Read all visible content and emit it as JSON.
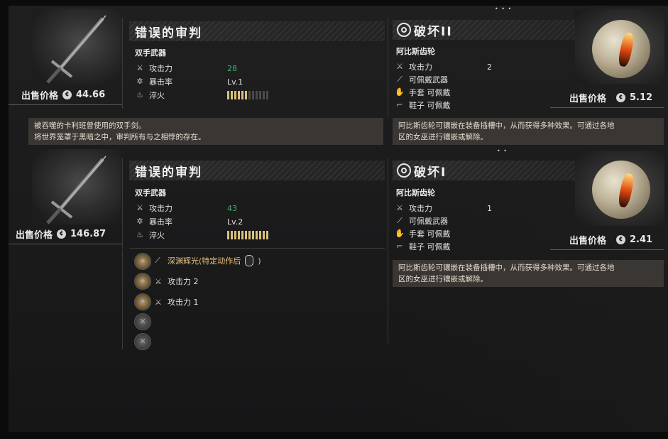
{
  "top_item": {
    "name": "错误的审判",
    "category": "双手武器",
    "price_label": "出售价格",
    "price_value": "44.66",
    "stats": [
      {
        "icon": "sword-icon",
        "label": "攻击力",
        "value": "28",
        "highlight": true
      },
      {
        "icon": "crit-icon",
        "label": "暴击率",
        "value": "Lv.1",
        "highlight": false
      },
      {
        "icon": "temper-icon",
        "label": "淬火",
        "level": 6,
        "max": 12
      }
    ],
    "description": [
      "被吞噬的卡利班曾使用的双手剑。",
      "将世界笼罩于黑暗之中，审判所有与之相悖的存在。"
    ]
  },
  "bottom_item": {
    "name": "错误的审判",
    "category": "双手武器",
    "price_label": "出售价格",
    "price_value": "146.87",
    "stats": [
      {
        "icon": "sword-icon",
        "label": "攻击力",
        "value": "43",
        "highlight": true
      },
      {
        "icon": "crit-icon",
        "label": "暴击率",
        "value": "Lv.2",
        "highlight": false
      },
      {
        "icon": "temper-icon",
        "label": "淬火",
        "level": 12,
        "max": 12
      }
    ],
    "skills": [
      {
        "label": "深渊辉光(特定动作后",
        "suffix": ")",
        "highlight": true
      },
      {
        "label": "攻击力 2",
        "highlight": false
      },
      {
        "label": "攻击力 1",
        "highlight": false
      }
    ]
  },
  "top_rune": {
    "name": "破坏II",
    "category": "阿比斯齿轮",
    "price_label": "出售价格",
    "price_value": "5.12",
    "stats": [
      {
        "label": "攻击力",
        "value": "2"
      },
      {
        "label": "可佩戴武器",
        "value": ""
      },
      {
        "label": "手套  可佩戴",
        "value": ""
      },
      {
        "label": "鞋子  可佩戴",
        "value": ""
      }
    ],
    "description": [
      "阿比斯齿轮可镶嵌在装备插槽中，从而获得多种效果。可通过各地",
      "区的女巫进行镶嵌或解除。"
    ]
  },
  "bottom_rune": {
    "name": "破坏I",
    "category": "阿比斯齿轮",
    "price_label": "出售价格",
    "price_value": "2.41",
    "stats": [
      {
        "label": "攻击力",
        "value": "1"
      },
      {
        "label": "可佩戴武器",
        "value": ""
      },
      {
        "label": "手套  可佩戴",
        "value": ""
      },
      {
        "label": "鞋子  可佩戴",
        "value": ""
      }
    ],
    "description": [
      "阿比斯齿轮可镶嵌在装备插槽中，从而获得多种效果。可通过各地",
      "区的女巫进行镶嵌或解除。"
    ]
  },
  "colors": {
    "highlight_green": "#3fb36b",
    "gold": "#e6c27a",
    "desc_bg": "#3a3633"
  },
  "coin_symbol": "¢"
}
